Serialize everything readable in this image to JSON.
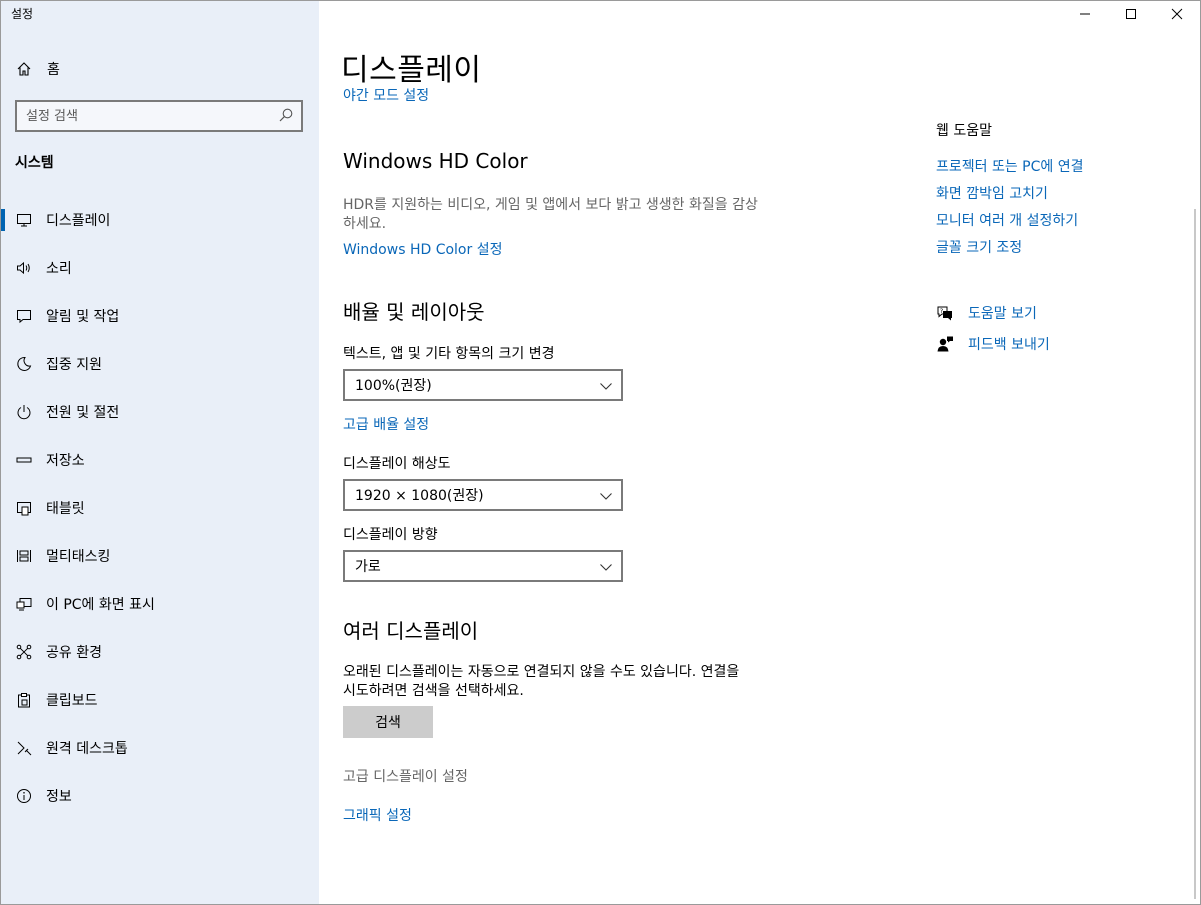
{
  "app": {
    "title": "설정"
  },
  "sidebar": {
    "home_label": "홈",
    "search_placeholder": "설정 검색",
    "section_title": "시스템",
    "items": [
      {
        "label": "디스플레이",
        "icon": "monitor-icon",
        "active": true
      },
      {
        "label": "소리",
        "icon": "speaker-icon"
      },
      {
        "label": "알림 및 작업",
        "icon": "notification-icon"
      },
      {
        "label": "집중 지원",
        "icon": "moon-icon"
      },
      {
        "label": "전원 및 절전",
        "icon": "power-icon"
      },
      {
        "label": "저장소",
        "icon": "storage-icon"
      },
      {
        "label": "태블릿",
        "icon": "tablet-icon"
      },
      {
        "label": "멀티태스킹",
        "icon": "multitasking-icon"
      },
      {
        "label": "이 PC에 화면 표시",
        "icon": "project-icon"
      },
      {
        "label": "공유 환경",
        "icon": "shared-experiences-icon"
      },
      {
        "label": "클립보드",
        "icon": "clipboard-icon"
      },
      {
        "label": "원격 데스크톱",
        "icon": "remote-desktop-icon"
      },
      {
        "label": "정보",
        "icon": "info-icon"
      }
    ]
  },
  "main": {
    "title": "디스플레이",
    "night_light_link": "야간 모드 설정",
    "hdr": {
      "heading": "Windows HD Color",
      "description_line1": "HDR를 지원하는 비디오, 게임 및 앱에서 보다 밝고 생생한 화질을 감상",
      "description_line2": "하세요.",
      "link": "Windows HD Color 설정"
    },
    "scale_layout": {
      "heading": "배율 및 레이아웃",
      "scale_label": "텍스트, 앱 및 기타 항목의 크기 변경",
      "scale_value": "100%(권장)",
      "advanced_scaling_link": "고급 배율 설정",
      "resolution_label": "디스플레이 해상도",
      "resolution_value": "1920 × 1080(권장)",
      "orientation_label": "디스플레이 방향",
      "orientation_value": "가로"
    },
    "multiple_displays": {
      "heading": "여러 디스플레이",
      "description_line1": "오래된 디스플레이는 자동으로 연결되지 않을 수도 있습니다. 연결을",
      "description_line2": "시도하려면 검색을 선택하세요.",
      "detect_button": "검색",
      "advanced_display_settings": "고급 디스플레이 설정",
      "graphics_settings_link": "그래픽 설정"
    }
  },
  "help": {
    "web_help_title": "웹 도움말",
    "links": [
      "프로젝터 또는 PC에 연결",
      "화면 깜박임 고치기",
      "모니터 여러 개 설정하기",
      "글꼴 크기 조정"
    ],
    "get_help": "도움말 보기",
    "give_feedback": "피드백 보내기"
  },
  "colors": {
    "accent": "#0063b1",
    "link": "#0a67b8",
    "sidebar_bg": "#e9eff8"
  }
}
